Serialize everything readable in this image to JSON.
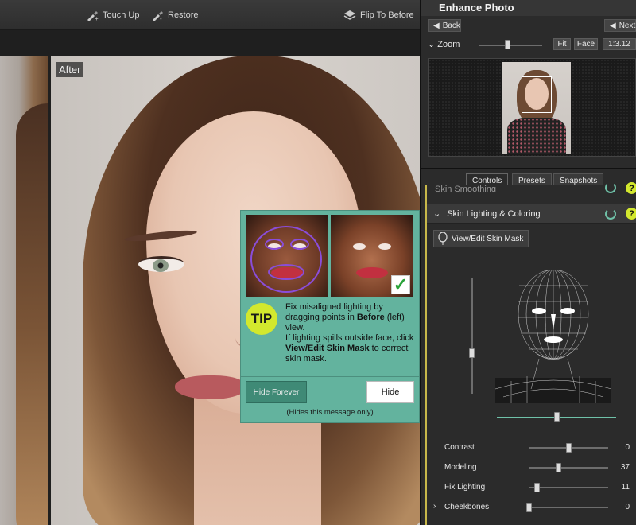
{
  "toolbar": {
    "touch_up": "Touch Up",
    "restore": "Restore",
    "flip": "Flip To Before"
  },
  "workspace": {
    "after_label": "After"
  },
  "tip": {
    "badge": "TIP",
    "line1a": "Fix misaligned lighting by dragging points in ",
    "line1b": "Before",
    "line1c": " (left) view.",
    "line2a": "If lighting spills outside face, click ",
    "line2b": "View/Edit Skin Mask",
    "line2c": " to correct skin mask.",
    "hide_forever": "Hide Forever",
    "hide": "Hide",
    "note": "(Hides this message only)"
  },
  "panel": {
    "title": "Enhance Photo",
    "back": "Back",
    "next": "Next",
    "zoom_label": "Zoom",
    "fit": "Fit",
    "face": "Face",
    "ratio": "1:3.12",
    "zoom_level": 0.45
  },
  "tabs": [
    "Controls",
    "Presets",
    "Snapshots"
  ],
  "controls": {
    "cut_section": "Skin Smoothing",
    "section_title": "Skin Lighting & Coloring",
    "mask_button": "View/Edit Skin Mask",
    "vertical_level": 0.35,
    "horizontal_level": 0.5,
    "sliders": [
      {
        "label": "Contrast",
        "value": "0",
        "level": 0.5
      },
      {
        "label": "Modeling",
        "value": "37",
        "level": 0.37
      },
      {
        "label": "Fix Lighting",
        "value": "11",
        "level": 0.1
      },
      {
        "label": "Cheekbones",
        "value": "0",
        "level": 0.0
      }
    ]
  },
  "colors": {
    "tip_bg": "#63b39e",
    "accent_teal": "#6fc1a8",
    "help_yellow": "#d3e82e",
    "section_rail": "#c8b84a"
  }
}
